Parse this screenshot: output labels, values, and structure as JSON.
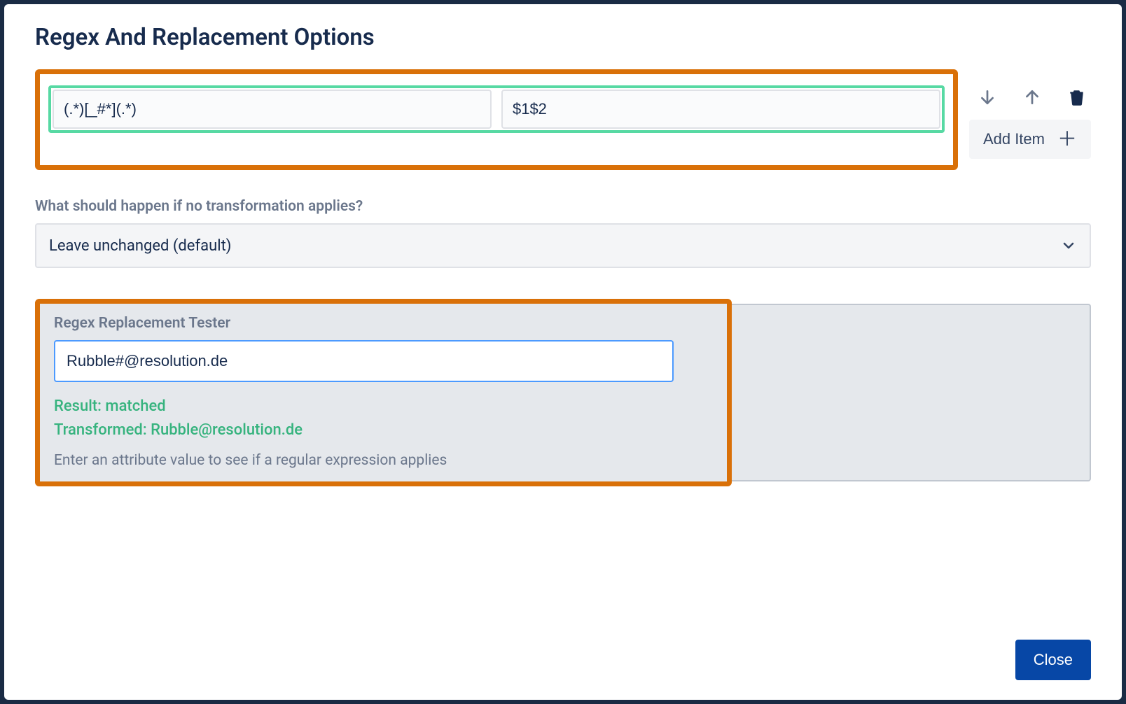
{
  "modal": {
    "title": "Regex And Replacement Options"
  },
  "rules": [
    {
      "pattern": "(.*)[_#*](.*)",
      "replacement": "$1$2"
    }
  ],
  "actions": {
    "addItem": "Add Item"
  },
  "fallback": {
    "label": "What should happen if no transformation applies?",
    "selected": "Leave unchanged (default)"
  },
  "tester": {
    "title": "Regex Replacement Tester",
    "input": "Rubble#@resolution.de",
    "resultLabel": "Result:",
    "resultValue": "matched",
    "transformedLabel": "Transformed:",
    "transformedValue": "Rubble@resolution.de",
    "help": "Enter an attribute value to see if a regular expression applies"
  },
  "footer": {
    "close": "Close"
  }
}
